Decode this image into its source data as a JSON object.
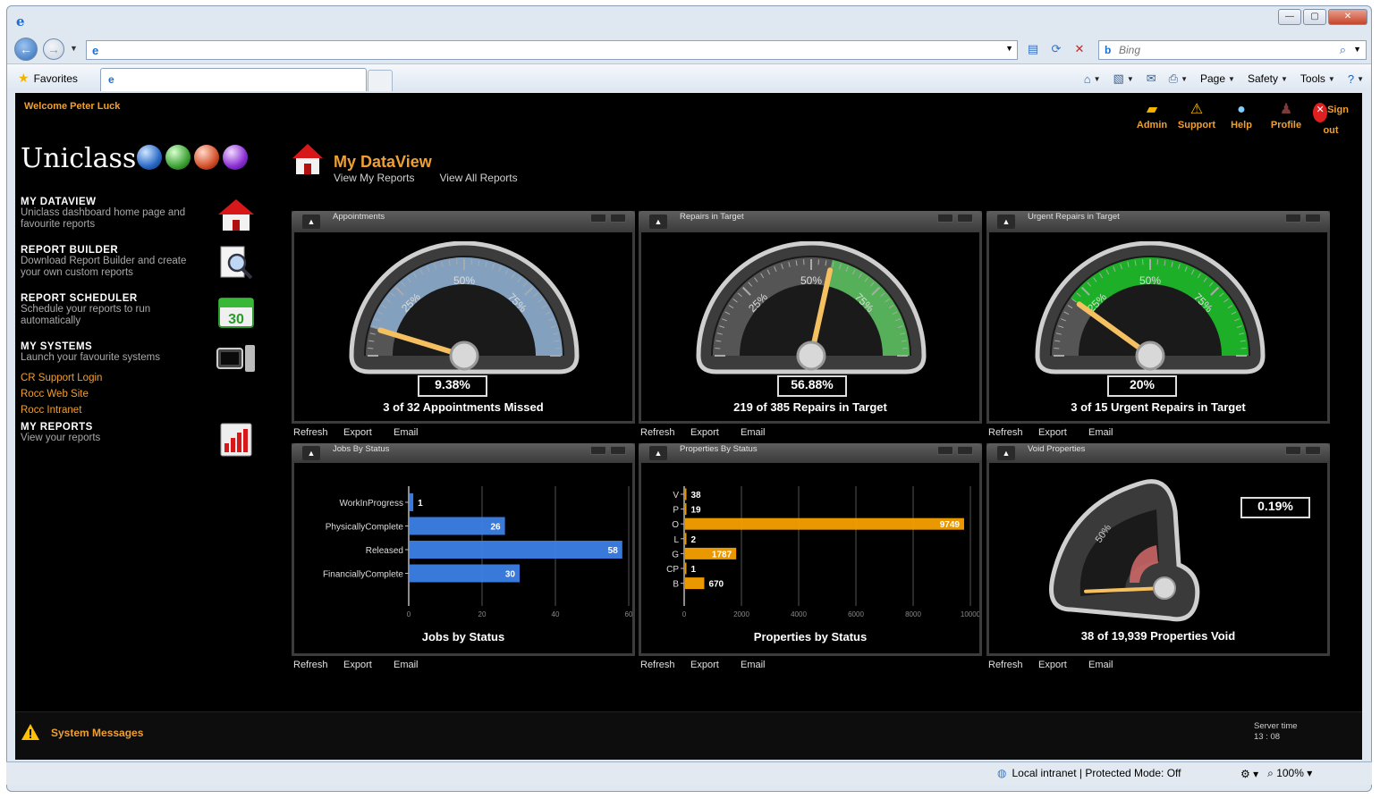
{
  "browser": {
    "address": "",
    "search_placeholder": "Bing",
    "favorites_label": "Favorites",
    "commands": [
      "Page",
      "Safety",
      "Tools"
    ],
    "status_zone": "Local intranet | Protected Mode: Off",
    "zoom": "100%"
  },
  "app": {
    "welcome": "Welcome Peter Luck",
    "topnav": [
      "Admin",
      "Support",
      "Help",
      "Profile",
      "Sign out"
    ],
    "brand": "Uniclass",
    "menu": [
      {
        "title": "MY DATAVIEW",
        "desc": "Uniclass dashboard home page and favourite reports"
      },
      {
        "title": "REPORT BUILDER",
        "desc": "Download Report Builder and create your own custom reports"
      },
      {
        "title": "REPORT SCHEDULER",
        "desc": "Schedule your reports to run automatically"
      },
      {
        "title": "MY SYSTEMS",
        "desc": "Launch your favourite systems"
      },
      {
        "title": "MY REPORTS",
        "desc": "View your reports"
      }
    ],
    "system_links": [
      "CR Support Login",
      "Rocc Web Site",
      "Rocc Intranet"
    ],
    "page_title": "My DataView",
    "page_links": [
      "View My Reports",
      "View All Reports"
    ],
    "widget_actions": [
      "Refresh",
      "Export",
      "Email"
    ],
    "system_messages": "System Messages",
    "server_time_label": "Server time",
    "server_time": "13 : 08",
    "calendar_day": "30"
  },
  "widgets": {
    "appointments": {
      "title": "Appointments",
      "value": "9.38%",
      "caption": "3 of 32 Appointments Missed",
      "gauge_fraction": 0.094,
      "fill_color": "#8fb0d0"
    },
    "repairs": {
      "title": "Repairs in Target",
      "value": "56.88%",
      "caption": "219 of 385 Repairs in Target",
      "gauge_fraction": 0.569,
      "fill_color": "#5dc060"
    },
    "urgent": {
      "title": "Urgent Repairs in Target",
      "value": "20%",
      "caption": "3 of 15 Urgent Repairs in Target",
      "gauge_fraction": 0.2,
      "fill_color": "#1fc02a"
    },
    "void": {
      "title": "Void Properties",
      "value": "0.19%",
      "caption": "38 of 19,939 Properties Void",
      "gauge_fraction": 0.002
    }
  },
  "gauge_ticks": [
    "25%",
    "50%",
    "75%"
  ],
  "void_tick": "50%",
  "chart_data": [
    {
      "type": "bar",
      "title": "Jobs by Status",
      "orientation": "horizontal",
      "categories": [
        "WorkInProgress",
        "PhysicallyComplete",
        "Released",
        "FinanciallyComplete"
      ],
      "values": [
        1,
        26,
        58,
        30
      ],
      "xlim": [
        0,
        60
      ],
      "xticks": [
        0,
        20,
        40,
        60
      ],
      "color": "#3b7fe6"
    },
    {
      "type": "bar",
      "title": "Properties by Status",
      "orientation": "horizontal",
      "categories": [
        "V",
        "P",
        "O",
        "L",
        "G",
        "CP",
        "B"
      ],
      "values": [
        38,
        19,
        9749,
        2,
        1787,
        1,
        670
      ],
      "xlim": [
        0,
        10000
      ],
      "xticks": [
        0,
        2000,
        4000,
        6000,
        8000,
        10000
      ],
      "color": "#f5a000"
    }
  ]
}
